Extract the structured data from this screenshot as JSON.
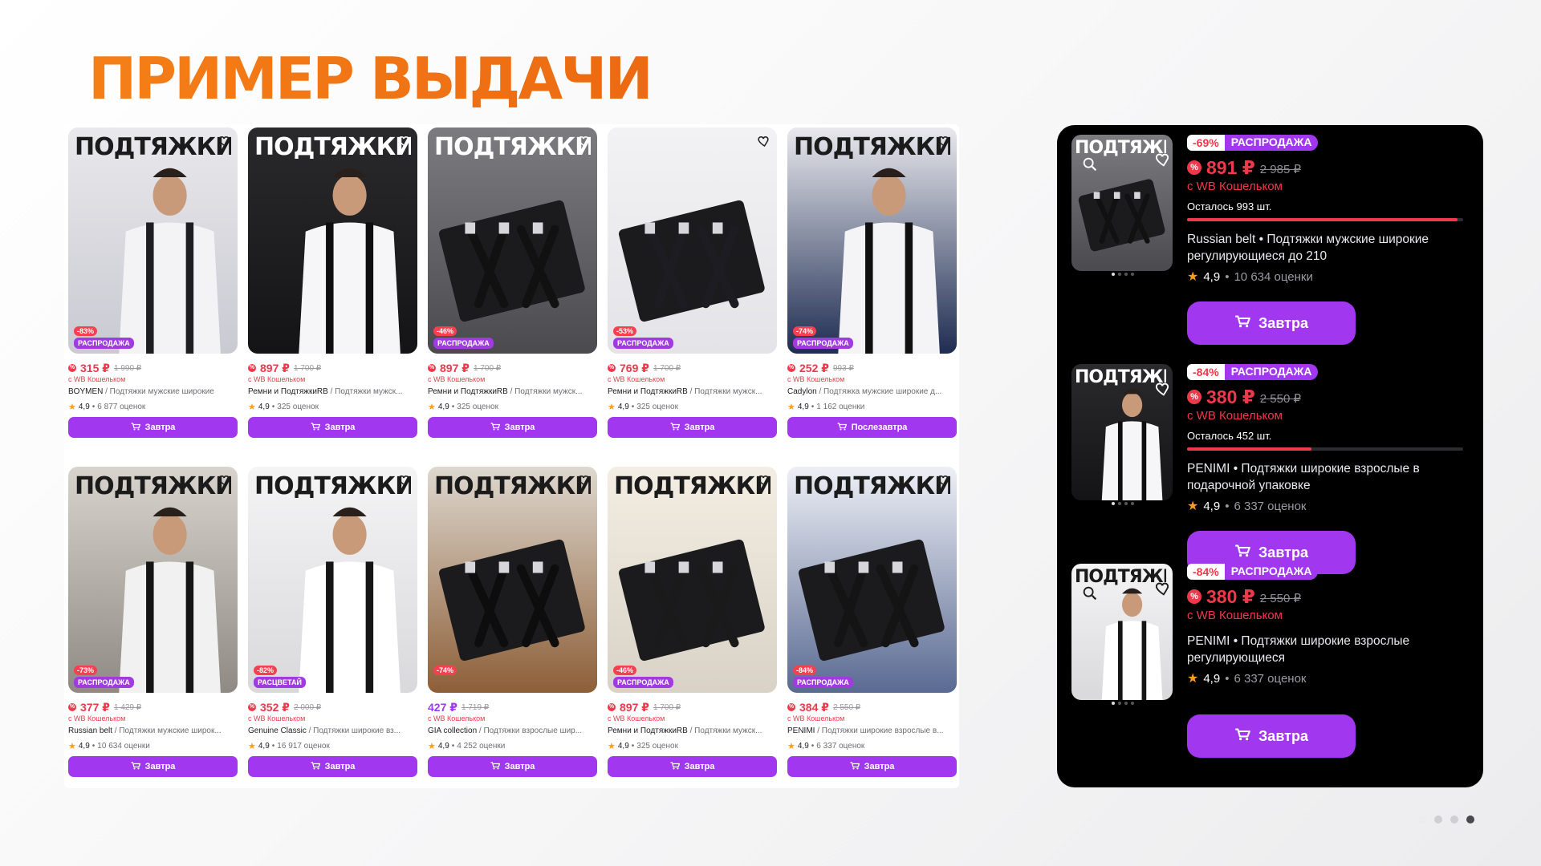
{
  "page": {
    "title": "ПРИМЕР ВЫДАЧИ"
  },
  "grid": {
    "cards": [
      {
        "image_text": "ПОДТЯЖКИ",
        "image_theme": "light",
        "discount": "-83%",
        "badge": "РАСПРОДАЖА",
        "price": "315 ₽",
        "old_price": "1 990 ₽",
        "wallet": "с WB Кошельком",
        "brand": "BOYMEN",
        "title": " / Подтяжки мужские широкие",
        "rating": "4,9",
        "reviews": "6 877 оценок",
        "button": "Завтра",
        "price_style": "wallet"
      },
      {
        "image_text": "ПОДТЯЖКИ",
        "image_theme": "dark",
        "discount": "",
        "badge": "",
        "price": "897 ₽",
        "old_price": "1 700 ₽",
        "wallet": "с WB Кошельком",
        "brand": "Ремни и ПодтяжкиRB",
        "title": " / Подтяжки мужск...",
        "rating": "4,9",
        "reviews": "325 оценок",
        "button": "Завтра",
        "price_style": "wallet"
      },
      {
        "image_text": "ПОДТЯЖКИ",
        "image_theme": "grey",
        "discount": "-46%",
        "badge": "РАСПРОДАЖА",
        "price": "897 ₽",
        "old_price": "1 700 ₽",
        "wallet": "с WB Кошельком",
        "brand": "Ремни и ПодтяжкиRB",
        "title": " / Подтяжки мужск...",
        "rating": "4,9",
        "reviews": "325 оценок",
        "button": "Завтра",
        "price_style": "wallet"
      },
      {
        "image_text": "",
        "image_theme": "white",
        "discount": "-53%",
        "badge": "РАСПРОДАЖА",
        "price": "769 ₽",
        "old_price": "1 700 ₽",
        "wallet": "с WB Кошельком",
        "brand": "Ремни и ПодтяжкиRB",
        "title": " / Подтяжки мужск...",
        "rating": "4,9",
        "reviews": "325 оценок",
        "button": "Завтра",
        "price_style": "wallet"
      },
      {
        "image_text": "ПОДТЯЖКИ",
        "image_theme": "navy",
        "discount": "-74%",
        "badge": "РАСПРОДАЖА",
        "price": "252 ₽",
        "old_price": "993 ₽",
        "wallet": "с WB Кошельком",
        "brand": "Cadylon",
        "title": " / Подтяжка мужские широкие д...",
        "rating": "4,9",
        "reviews": "1 162 оценки",
        "button": "Послезавтра",
        "price_style": "wallet"
      },
      {
        "image_text": "ПОДТЯЖКИ",
        "image_theme": "taupe",
        "discount": "-73%",
        "badge": "РАСПРОДАЖА",
        "price": "377 ₽",
        "old_price": "1 429 ₽",
        "wallet": "с WB Кошельком",
        "brand": "Russian belt",
        "title": " / Подтяжки мужские широк...",
        "rating": "4,9",
        "reviews": "10 634 оценки",
        "button": "Завтра",
        "price_style": "wallet"
      },
      {
        "image_text": "ПОДТЯЖКИ",
        "image_theme": "lightgrey",
        "discount": "-82%",
        "badge": "РАСЦВЕТАЙ",
        "price": "352 ₽",
        "old_price": "2 000 ₽",
        "wallet": "с WB Кошельком",
        "brand": "Genuine Classic",
        "title": " / Подтяжки широкие вз...",
        "rating": "4,9",
        "reviews": "16 917 оценок",
        "button": "Завтра",
        "price_style": "wallet"
      },
      {
        "image_text": "ПОДТЯЖКИ",
        "image_theme": "wood",
        "discount": "-74%",
        "badge": "",
        "price": "427 ₽",
        "old_price": "1 719 ₽",
        "wallet": "с WB Кошельком",
        "brand": "GIA collection",
        "title": " / Подтяжки взрослые шир...",
        "rating": "4,9",
        "reviews": "4 252 оценки",
        "button": "Завтра",
        "price_style": "plain"
      },
      {
        "image_text": "ПОДТЯЖКИ",
        "image_theme": "box",
        "discount": "-46%",
        "badge": "РАСПРОДАЖА",
        "price": "897 ₽",
        "old_price": "1 700 ₽",
        "wallet": "с WB Кошельком",
        "brand": "Ремни и ПодтяжкиRB",
        "title": " / Подтяжки мужск...",
        "rating": "4,9",
        "reviews": "325 оценок",
        "button": "Завтра",
        "price_style": "wallet"
      },
      {
        "image_text": "ПОДТЯЖКИ",
        "image_theme": "blue",
        "discount": "-84%",
        "badge": "РАСПРОДАЖА",
        "price": "384 ₽",
        "old_price": "2 550 ₽",
        "wallet": "с WB Кошельком",
        "brand": "PENIMI",
        "title": " / Подтяжки широкие взрослые в...",
        "rating": "4,9",
        "reviews": "6 337 оценок",
        "button": "Завтра",
        "price_style": "wallet"
      }
    ]
  },
  "panel": {
    "items": [
      {
        "image_text": "ПОДТЯЖКИ",
        "discount": "-69%",
        "badge": "РАСПРОДАЖА",
        "price": "891 ₽",
        "old_price": "2 985 ₽",
        "wallet": "с WB Кошельком",
        "stock": "Осталось 993 шт.",
        "stock_level": 0.98,
        "title": "Russian belt • Подтяжки мужские широкие регулирующиеся до 210",
        "rating": "4,9",
        "reviews": "10 634 оценки",
        "button": "Завтра"
      },
      {
        "image_text": "ПОДТЯЖКИ",
        "discount": "-84%",
        "badge": "РАСПРОДАЖА",
        "price": "380 ₽",
        "old_price": "2 550 ₽",
        "wallet": "с WB Кошельком",
        "stock": "Осталось 452 шт.",
        "stock_level": 0.45,
        "title": "PENIMI • Подтяжки широкие взрослые в подарочной упаковке",
        "rating": "4,9",
        "reviews": "6 337 оценок",
        "button": "Завтра"
      },
      {
        "image_text": "ПОДТЯЖКИ",
        "discount": "-84%",
        "badge": "РАСПРОДАЖА",
        "price": "380 ₽",
        "old_price": "2 550 ₽",
        "wallet": "с WB Кошельком",
        "stock": "",
        "stock_level": null,
        "title": "PENIMI • Подтяжки широкие взрослые регулирующиеся",
        "rating": "4,9",
        "reviews": "6 337 оценок",
        "button": "Завтра"
      }
    ]
  },
  "icons": {
    "heart": "heart-icon",
    "cart": "cart-icon",
    "star": "star-icon",
    "wallet": "wallet-percent-icon",
    "zoom": "zoom-search-icon"
  },
  "colors": {
    "title": "#f2791c",
    "accent": "#a237f0",
    "price": "#f0384b",
    "panel_bg": "#000000"
  },
  "slide_dots": {
    "count": 4,
    "active": 4
  }
}
